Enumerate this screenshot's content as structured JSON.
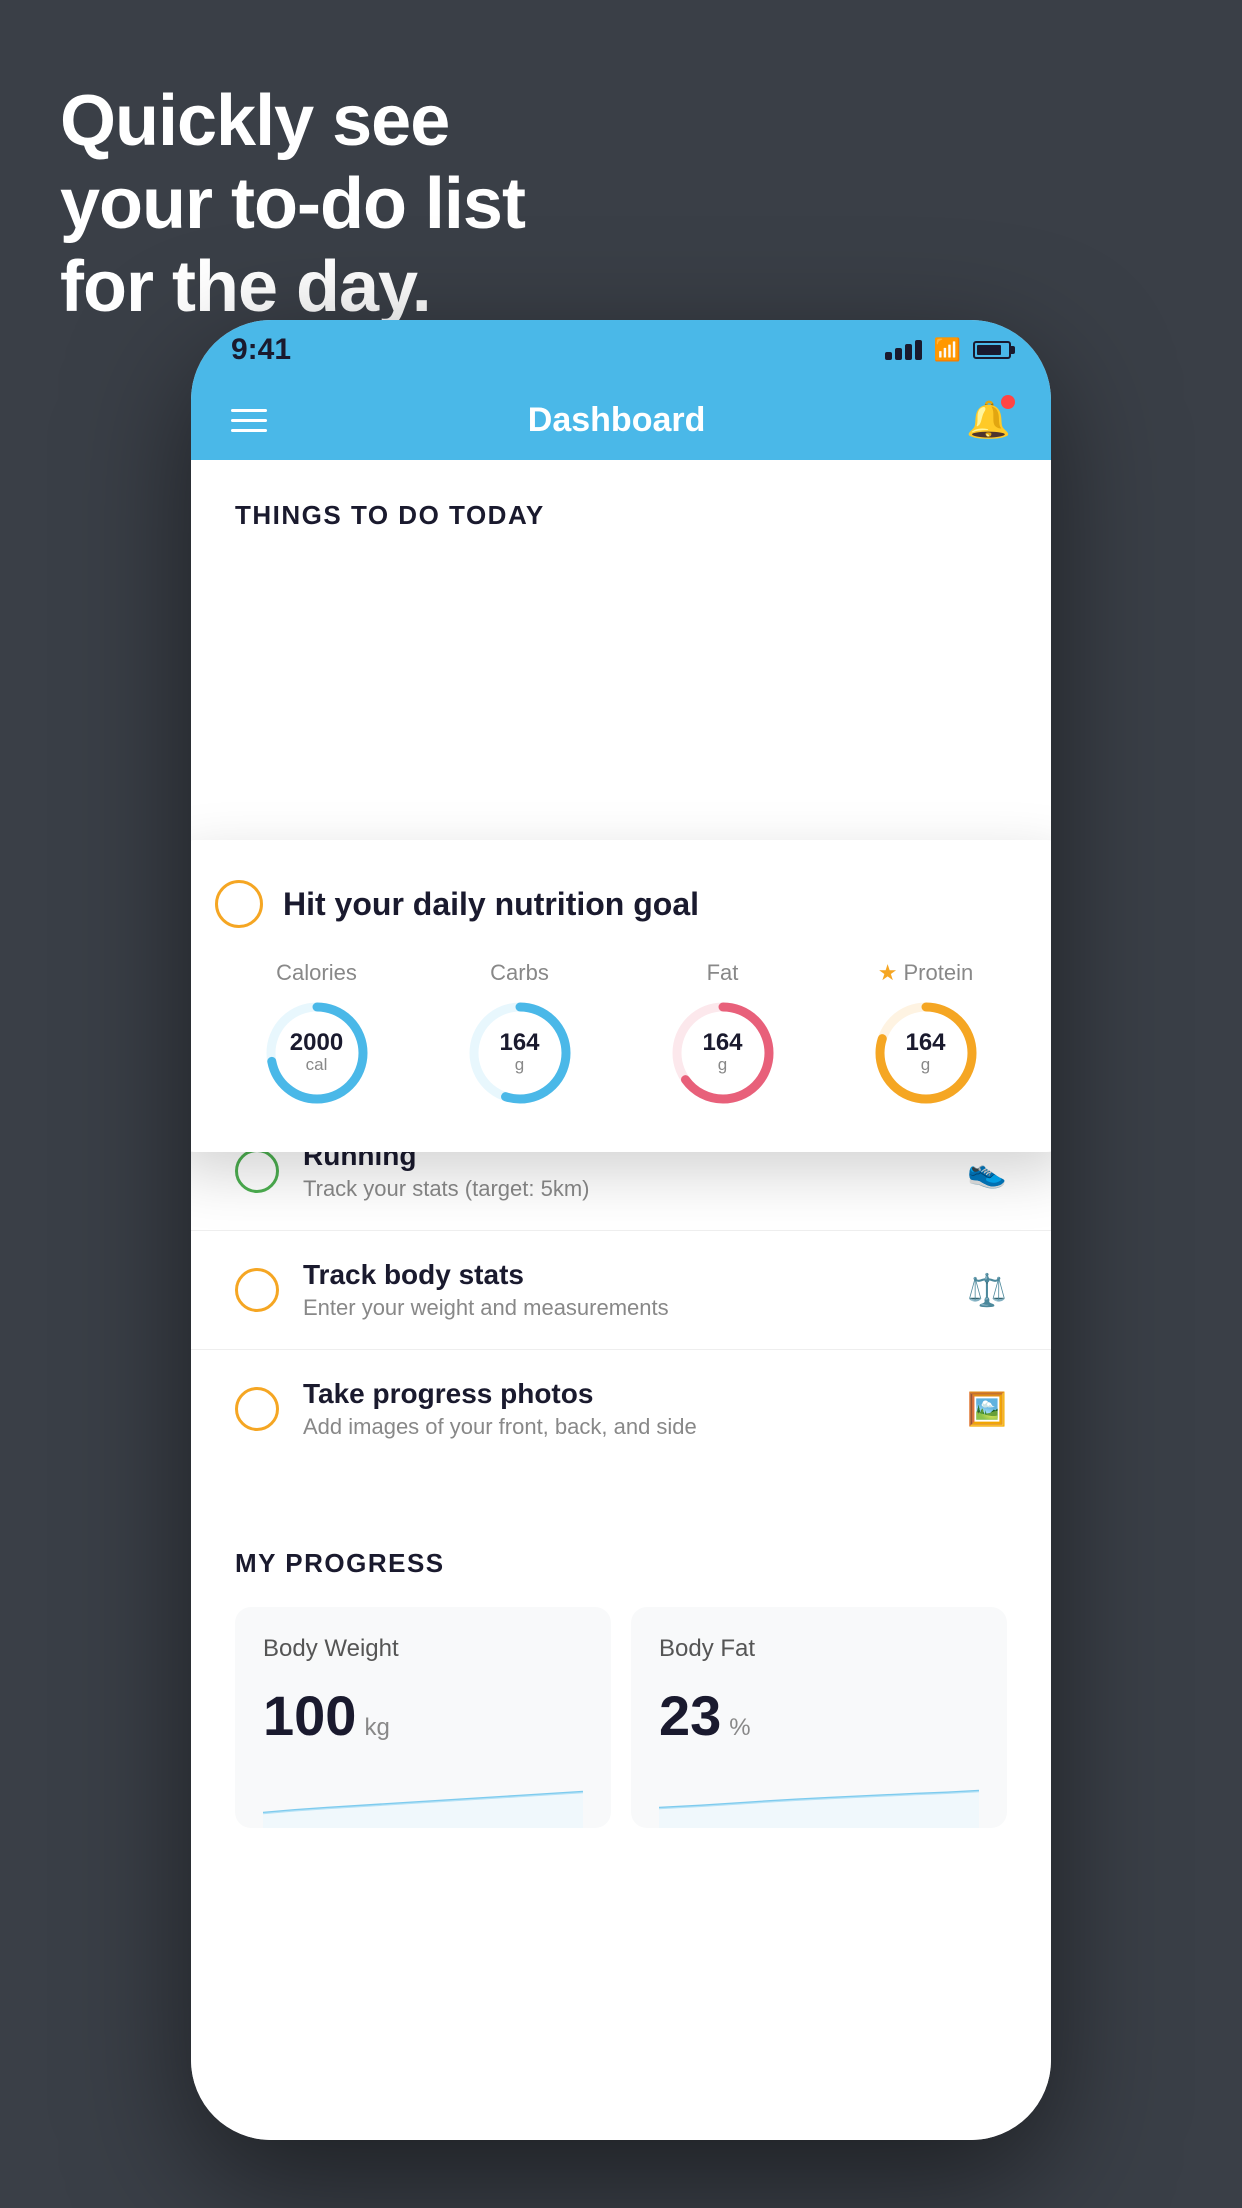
{
  "hero": {
    "line1": "Quickly see",
    "line2": "your to-do list",
    "line3": "for the day."
  },
  "status_bar": {
    "time": "9:41"
  },
  "nav": {
    "title": "Dashboard"
  },
  "things_header": "THINGS TO DO TODAY",
  "floating_card": {
    "title": "Hit your daily nutrition goal",
    "nutrition": [
      {
        "label": "Calories",
        "value": "2000",
        "unit": "cal",
        "color": "#4ab8e8",
        "track": 72
      },
      {
        "label": "Carbs",
        "value": "164",
        "unit": "g",
        "color": "#4ab8e8",
        "track": 55
      },
      {
        "label": "Fat",
        "value": "164",
        "unit": "g",
        "color": "#e8607a",
        "track": 65
      },
      {
        "label": "Protein",
        "value": "164",
        "unit": "g",
        "color": "#f5a623",
        "track": 80,
        "starred": true
      }
    ]
  },
  "todo_items": [
    {
      "title": "Running",
      "subtitle": "Track your stats (target: 5km)",
      "circle_color": "green",
      "icon": "shoe"
    },
    {
      "title": "Track body stats",
      "subtitle": "Enter your weight and measurements",
      "circle_color": "yellow",
      "icon": "scale"
    },
    {
      "title": "Take progress photos",
      "subtitle": "Add images of your front, back, and side",
      "circle_color": "yellow",
      "icon": "photo"
    }
  ],
  "progress": {
    "header": "MY PROGRESS",
    "cards": [
      {
        "title": "Body Weight",
        "value": "100",
        "unit": "kg"
      },
      {
        "title": "Body Fat",
        "value": "23",
        "unit": "%"
      }
    ]
  }
}
